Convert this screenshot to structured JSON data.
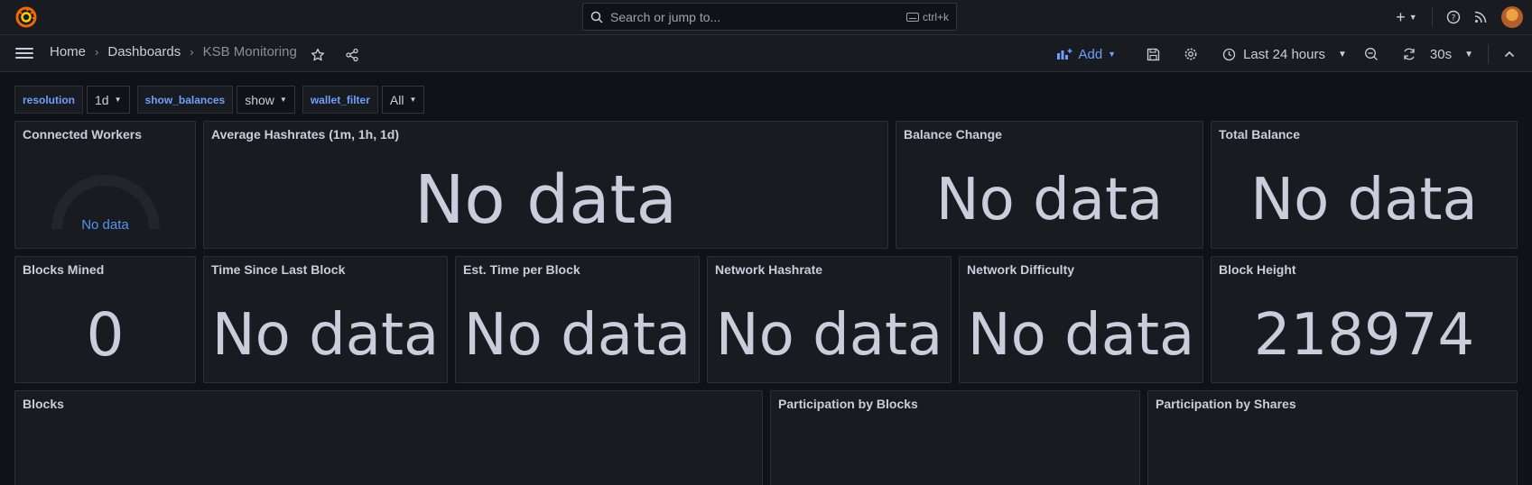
{
  "topbar": {
    "search_placeholder": "Search or jump to...",
    "search_shortcut": "ctrl+k"
  },
  "navbar": {
    "breadcrumb": [
      "Home",
      "Dashboards",
      "KSB Monitoring"
    ],
    "add_label": "Add",
    "time_range": "Last 24 hours",
    "refresh_interval": "30s"
  },
  "variables": [
    {
      "name": "resolution",
      "value": "1d"
    },
    {
      "name": "show_balances",
      "value": "show"
    },
    {
      "name": "wallet_filter",
      "value": "All"
    }
  ],
  "panels": {
    "connected_workers": {
      "title": "Connected Workers",
      "value": "No data"
    },
    "avg_hashrates": {
      "title": "Average Hashrates (1m, 1h, 1d)",
      "value": "No data"
    },
    "balance_change": {
      "title": "Balance Change",
      "value": "No data"
    },
    "total_balance": {
      "title": "Total Balance",
      "value": "No data"
    },
    "blocks_mined": {
      "title": "Blocks Mined",
      "value": "0"
    },
    "time_since_last_block": {
      "title": "Time Since Last Block",
      "value": "No data"
    },
    "est_time_per_block": {
      "title": "Est. Time per Block",
      "value": "No data"
    },
    "network_hashrate": {
      "title": "Network Hashrate",
      "value": "No data"
    },
    "network_difficulty": {
      "title": "Network Difficulty",
      "value": "No data"
    },
    "block_height": {
      "title": "Block Height",
      "value": "218974"
    },
    "blocks": {
      "title": "Blocks"
    },
    "participation_blocks": {
      "title": "Participation by Blocks"
    },
    "participation_shares": {
      "title": "Participation by Shares"
    }
  },
  "colors": {
    "accent": "#6e9fff",
    "gauge_text": "#5794f2",
    "panel_bg": "#181b1f",
    "page_bg": "#111217"
  }
}
